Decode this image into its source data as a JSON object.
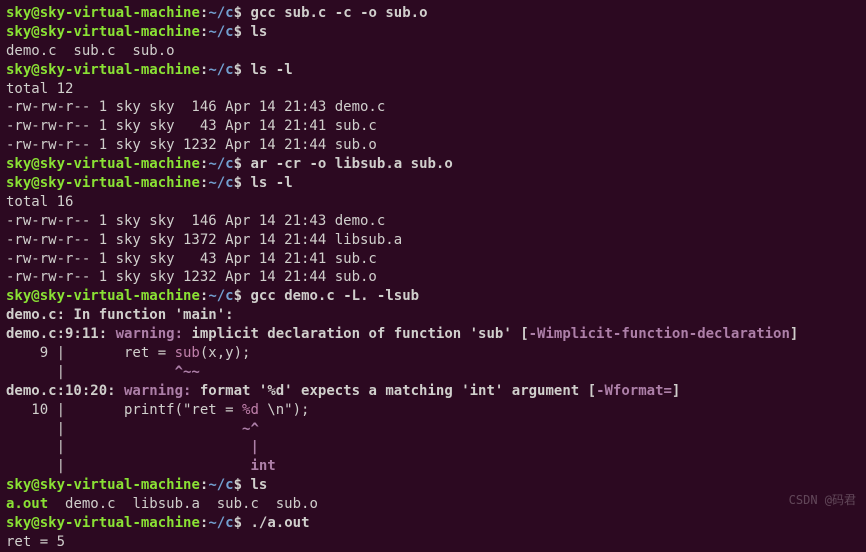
{
  "prompt": {
    "user": "sky",
    "at": "@",
    "host": "sky-virtual-machine",
    "colon": ":",
    "path": "~/c",
    "dollar": "$"
  },
  "cmds": {
    "c1": " gcc sub.c -c -o sub.o",
    "c2": " ls",
    "c3": " ls -l",
    "c4": " ar -cr -o libsub.a sub.o",
    "c5": " ls -l",
    "c6": " gcc demo.c -L. -lsub",
    "c7": " ls",
    "c8": " ./a.out"
  },
  "ls1": "demo.c  sub.c  sub.o",
  "ll1": {
    "total": "total 12",
    "r1": "-rw-rw-r-- 1 sky sky  146 Apr 14 21:43 demo.c",
    "r2": "-rw-rw-r-- 1 sky sky   43 Apr 14 21:41 sub.c",
    "r3": "-rw-rw-r-- 1 sky sky 1232 Apr 14 21:44 sub.o"
  },
  "ll2": {
    "total": "total 16",
    "r1": "-rw-rw-r-- 1 sky sky  146 Apr 14 21:43 demo.c",
    "r2": "-rw-rw-r-- 1 sky sky 1372 Apr 14 21:44 libsub.a",
    "r3": "-rw-rw-r-- 1 sky sky   43 Apr 14 21:41 sub.c",
    "r4": "-rw-rw-r-- 1 sky sky 1232 Apr 14 21:44 sub.o"
  },
  "warn1": {
    "file": "demo.c:",
    "infn": " In function ",
    "fn": "'main'",
    "tail": ":"
  },
  "w1loc": "demo.c:9:11:",
  "w1lbl": " warning: ",
  "w1msg1": "implicit declaration of function ",
  "w1sub": "'sub'",
  "w1msg2": " [",
  "w1flag": "-Wimplicit-function-declaration",
  "w1msg3": "]",
  "w1src1a": "    9 |       ret = ",
  "w1src1b": "sub",
  "w1src1c": "(x,y);",
  "w1src2a": "      |             ",
  "w1src2b": "^~~",
  "w2loc": "demo.c:10:20:",
  "w2lbl": " warning: ",
  "w2msg1": "format ",
  "w2fmt": "'%d'",
  "w2msg2": " expects a matching ",
  "w2int": "'int'",
  "w2msg3": " argument [",
  "w2flag": "-Wformat=",
  "w2msg4": "]",
  "w2src1": "   10 |       printf(\"ret = ",
  "w2src1b": "%d",
  "w2src1c": " \\n\");",
  "w2src2a": "      |                     ",
  "w2src2b": "~^",
  "w2src3a": "      |                      ",
  "w2src3b": "|",
  "w2src4a": "      |                      ",
  "w2src4b": "int",
  "ls2a": "a.out",
  "ls2b": "  demo.c  libsub.a  sub.c  sub.o",
  "ret": "ret = 5",
  "watermark": "CSDN @码君"
}
